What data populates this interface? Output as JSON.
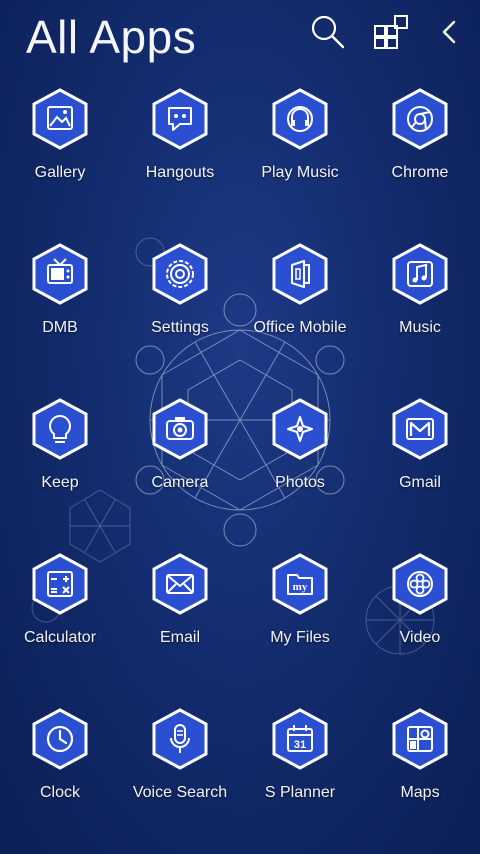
{
  "header": {
    "title": "All Apps",
    "icons": [
      "search-icon",
      "app-layout-icon",
      "back-chevron-icon"
    ]
  },
  "apps": [
    {
      "label": "Gallery",
      "icon": "gallery-icon"
    },
    {
      "label": "Hangouts",
      "icon": "hangouts-icon"
    },
    {
      "label": "Play Music",
      "icon": "play-music-icon"
    },
    {
      "label": "Chrome",
      "icon": "chrome-icon"
    },
    {
      "label": "DMB",
      "icon": "dmb-icon"
    },
    {
      "label": "Settings",
      "icon": "settings-icon"
    },
    {
      "label": "Office Mobile",
      "icon": "office-mobile-icon"
    },
    {
      "label": "Music",
      "icon": "music-icon"
    },
    {
      "label": "Keep",
      "icon": "keep-icon"
    },
    {
      "label": "Camera",
      "icon": "camera-icon"
    },
    {
      "label": "Photos",
      "icon": "photos-icon"
    },
    {
      "label": "Gmail",
      "icon": "gmail-icon"
    },
    {
      "label": "Calculator",
      "icon": "calculator-icon"
    },
    {
      "label": "Email",
      "icon": "email-icon"
    },
    {
      "label": "My Files",
      "icon": "my-files-icon"
    },
    {
      "label": "Video",
      "icon": "video-icon"
    },
    {
      "label": "Clock",
      "icon": "clock-icon"
    },
    {
      "label": "Voice Search",
      "icon": "voice-search-icon"
    },
    {
      "label": "S Planner",
      "icon": "s-planner-icon"
    },
    {
      "label": "Maps",
      "icon": "maps-icon"
    }
  ],
  "icon_texts": {
    "my_files": "my",
    "planner_day": "31"
  },
  "colors": {
    "background": "#132c6e",
    "hex_fill": "#2a4fd0",
    "hex_stroke": "#ffffff",
    "glyph": "#ffffff"
  }
}
